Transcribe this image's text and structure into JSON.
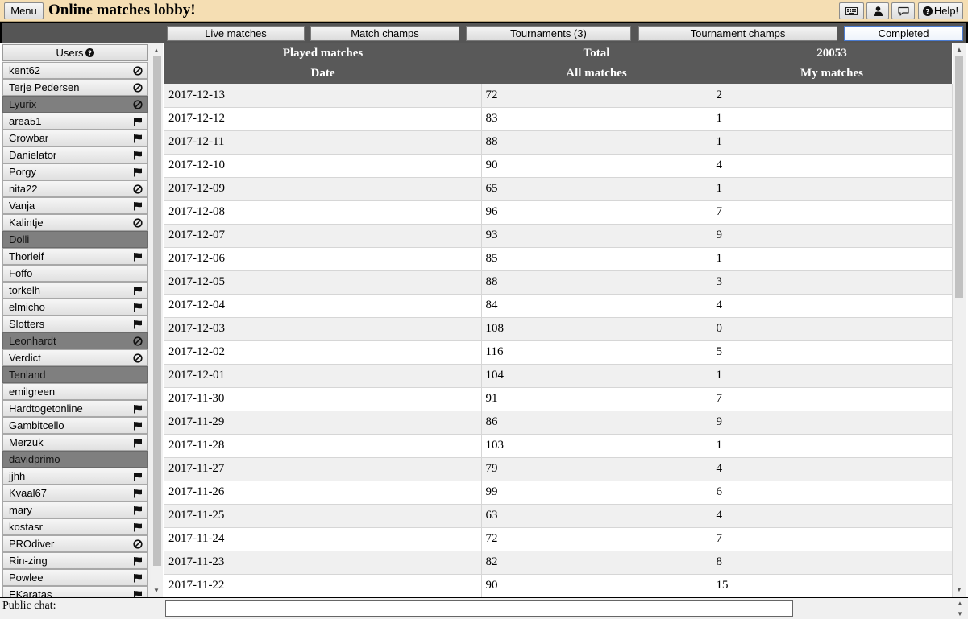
{
  "topbar": {
    "menu_label": "Menu",
    "title": "Online matches lobby!",
    "help_label": "Help!",
    "bg_color": "#f5deb3"
  },
  "tabs": [
    {
      "label": "Live matches",
      "active": false
    },
    {
      "label": "Match champs",
      "active": false
    },
    {
      "label": "Tournaments (3)",
      "active": false
    },
    {
      "label": "Tournament champs",
      "active": false
    },
    {
      "label": "Completed",
      "active": true
    }
  ],
  "users": {
    "header": "Users",
    "items": [
      {
        "name": "kent62",
        "icon": "block-icon",
        "dark": false
      },
      {
        "name": "Terje Pedersen",
        "icon": "block-icon",
        "dark": false
      },
      {
        "name": "Lyurix",
        "icon": "block-icon",
        "dark": true
      },
      {
        "name": "area51",
        "icon": "flag-icon",
        "dark": false
      },
      {
        "name": "Crowbar",
        "icon": "flag-icon",
        "dark": false
      },
      {
        "name": "Danielator",
        "icon": "flag-icon",
        "dark": false
      },
      {
        "name": "Porgy",
        "icon": "flag-icon",
        "dark": false
      },
      {
        "name": "nita22",
        "icon": "block-icon",
        "dark": false
      },
      {
        "name": "Vanja",
        "icon": "flag-icon",
        "dark": false
      },
      {
        "name": "Kalintje",
        "icon": "block-icon",
        "dark": false
      },
      {
        "name": "Dolli",
        "icon": "",
        "dark": true
      },
      {
        "name": "Thorleif",
        "icon": "flag-icon",
        "dark": false
      },
      {
        "name": "Foffo",
        "icon": "",
        "dark": false
      },
      {
        "name": "torkelh",
        "icon": "flag-icon",
        "dark": false
      },
      {
        "name": "elmicho",
        "icon": "flag-icon",
        "dark": false
      },
      {
        "name": "Slotters",
        "icon": "flag-icon",
        "dark": false
      },
      {
        "name": "Leonhardt",
        "icon": "block-icon",
        "dark": true
      },
      {
        "name": "Verdict",
        "icon": "block-icon",
        "dark": false
      },
      {
        "name": "Tenland",
        "icon": "",
        "dark": true
      },
      {
        "name": "emilgreen",
        "icon": "",
        "dark": false
      },
      {
        "name": "Hardtogetonline",
        "icon": "flag-icon",
        "dark": false
      },
      {
        "name": "Gambitcello",
        "icon": "flag-icon",
        "dark": false
      },
      {
        "name": "Merzuk",
        "icon": "flag-icon",
        "dark": false
      },
      {
        "name": "davidprimo",
        "icon": "",
        "dark": true
      },
      {
        "name": "jjhh",
        "icon": "flag-icon",
        "dark": false
      },
      {
        "name": "Kvaal67",
        "icon": "flag-icon",
        "dark": false
      },
      {
        "name": "mary",
        "icon": "flag-icon",
        "dark": false
      },
      {
        "name": "kostasr",
        "icon": "flag-icon",
        "dark": false
      },
      {
        "name": "PROdiver",
        "icon": "block-icon",
        "dark": false
      },
      {
        "name": "Rin-zing",
        "icon": "flag-icon",
        "dark": false
      },
      {
        "name": "Powlee",
        "icon": "flag-icon",
        "dark": false
      },
      {
        "name": "EKaratas",
        "icon": "flag-icon",
        "dark": false
      }
    ]
  },
  "stats": {
    "header_row1": [
      "Played matches",
      "Total",
      "20053"
    ],
    "header_row2": [
      "Date",
      "All matches",
      "My matches"
    ],
    "rows": [
      [
        "2017-12-13",
        "72",
        "2"
      ],
      [
        "2017-12-12",
        "83",
        "1"
      ],
      [
        "2017-12-11",
        "88",
        "1"
      ],
      [
        "2017-12-10",
        "90",
        "4"
      ],
      [
        "2017-12-09",
        "65",
        "1"
      ],
      [
        "2017-12-08",
        "96",
        "7"
      ],
      [
        "2017-12-07",
        "93",
        "9"
      ],
      [
        "2017-12-06",
        "85",
        "1"
      ],
      [
        "2017-12-05",
        "88",
        "3"
      ],
      [
        "2017-12-04",
        "84",
        "4"
      ],
      [
        "2017-12-03",
        "108",
        "0"
      ],
      [
        "2017-12-02",
        "116",
        "5"
      ],
      [
        "2017-12-01",
        "104",
        "1"
      ],
      [
        "2017-11-30",
        "91",
        "7"
      ],
      [
        "2017-11-29",
        "86",
        "9"
      ],
      [
        "2017-11-28",
        "103",
        "1"
      ],
      [
        "2017-11-27",
        "79",
        "4"
      ],
      [
        "2017-11-26",
        "99",
        "6"
      ],
      [
        "2017-11-25",
        "63",
        "4"
      ],
      [
        "2017-11-24",
        "72",
        "7"
      ],
      [
        "2017-11-23",
        "82",
        "8"
      ],
      [
        "2017-11-22",
        "90",
        "15"
      ]
    ]
  },
  "chat": {
    "label": "Public chat:",
    "value": ""
  }
}
